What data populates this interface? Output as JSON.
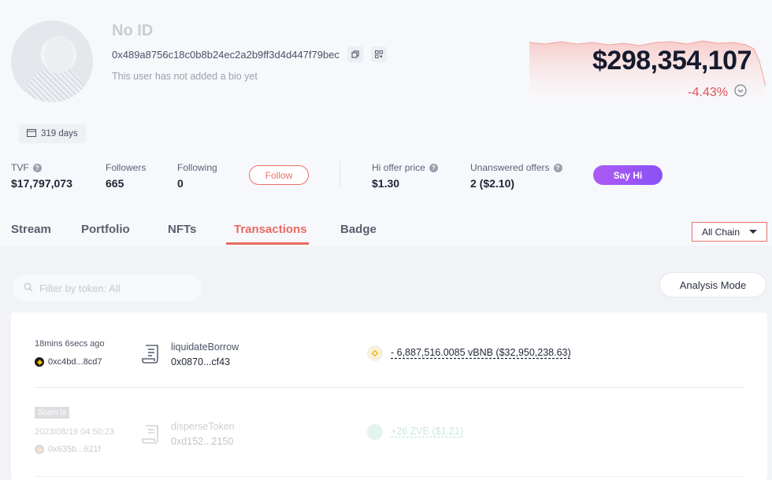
{
  "profile": {
    "name": "No ID",
    "address": "0x489a8756c18c0b8b24ec2a2b9ff3d4d447f79bec",
    "bio": "This user has not added a bio yet",
    "days": "319 days",
    "net_worth": "$298,354,107",
    "change": "-4.43%"
  },
  "stats": {
    "tvf_label": "TVF",
    "tvf_value": "$17,797,073",
    "followers_label": "Followers",
    "followers_value": "665",
    "following_label": "Following",
    "following_value": "0",
    "follow_button": "Follow",
    "hi_offer_label": "Hi offer price",
    "hi_offer_value": "$1.30",
    "unanswered_label": "Unanswered offers",
    "unanswered_value": "2 ($2.10)",
    "say_hi_button": "Say Hi"
  },
  "tabs": [
    {
      "label": "Stream"
    },
    {
      "label": "Portfolio"
    },
    {
      "label": "NFTs"
    },
    {
      "label": "Transactions",
      "active": true
    },
    {
      "label": "Badge"
    }
  ],
  "chain_filter": "All Chain",
  "filter": {
    "placeholder": "Filter by token: All"
  },
  "analysis_mode": "Analysis Mode",
  "transactions": [
    {
      "time": "18mins 6secs ago",
      "from": "0xc4bd...8cd7",
      "method": "liquidateBorrow",
      "contract": "0x0870...cf43",
      "amount": "- 6,887,516.0085 vBNB ($32,950,238.63)"
    },
    {
      "tag": "Scam tx",
      "time": "2023/08/19 04:50:23",
      "from": "0x635b...621f",
      "method": "disperseToken",
      "contract": "0xd152...2150",
      "amount": "+26 ZVE ($1.21)"
    }
  ],
  "colors": {
    "accent": "#e86b62",
    "negative": "#e0535d",
    "positive": "#36b37e",
    "purple": "#9b56f5"
  }
}
